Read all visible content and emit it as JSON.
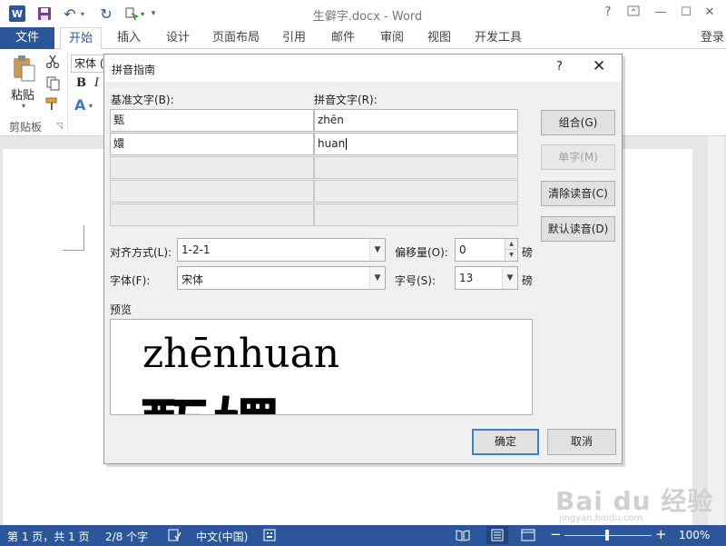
{
  "window": {
    "title": "生僻字.docx - Word",
    "logo_letter": "W",
    "help": "?",
    "minimize": "—",
    "maximize": "☐",
    "close": "✕"
  },
  "tabs": {
    "file": "文件",
    "items": [
      "开始",
      "插入",
      "设计",
      "页面布局",
      "引用",
      "邮件",
      "审阅",
      "视图",
      "开发工具"
    ],
    "active_index": 0,
    "signin": "登录"
  },
  "ribbon": {
    "paste_label": "粘贴",
    "clipboard_group": "剪贴板",
    "font_name": "宋体 (",
    "bold": "B",
    "italic": "I",
    "text_effect": "A"
  },
  "dialog": {
    "title": "拼音指南",
    "help": "?",
    "close": "✕",
    "base_text_label": "基准文字(B):",
    "ruby_text_label": "拼音文字(R):",
    "rows": [
      {
        "base": "甄",
        "ruby": "zhēn"
      },
      {
        "base": "嬛",
        "ruby": "huan"
      },
      {
        "base": "",
        "ruby": ""
      },
      {
        "base": "",
        "ruby": ""
      },
      {
        "base": "",
        "ruby": ""
      }
    ],
    "buttons": {
      "group": "组合(G)",
      "mono": "单字(M)",
      "clear": "清除读音(C)",
      "default": "默认读音(D)"
    },
    "align_label": "对齐方式(L):",
    "align_value": "1-2-1",
    "offset_label": "偏移量(O):",
    "offset_value": "0",
    "offset_unit": "磅",
    "font_label": "字体(F):",
    "font_value": "宋体",
    "size_label": "字号(S):",
    "size_value": "13",
    "size_unit": "磅",
    "preview_label": "预览",
    "preview_ruby": "zhēnhuan",
    "preview_base": "甄嬛",
    "ok": "确定",
    "cancel": "取消"
  },
  "statusbar": {
    "page": "第 1 页，共 1 页",
    "words": "2/8 个字",
    "language": "中文(中国)",
    "zoom_out": "−",
    "zoom_in": "+",
    "zoom": "100%",
    "zoom_percent": 100
  },
  "watermark": {
    "brand": "Bai du 经验",
    "url": "jingyan.baidu.com"
  },
  "colors": {
    "accent": "#2b579a",
    "ok_border": "#3c7fc4"
  }
}
